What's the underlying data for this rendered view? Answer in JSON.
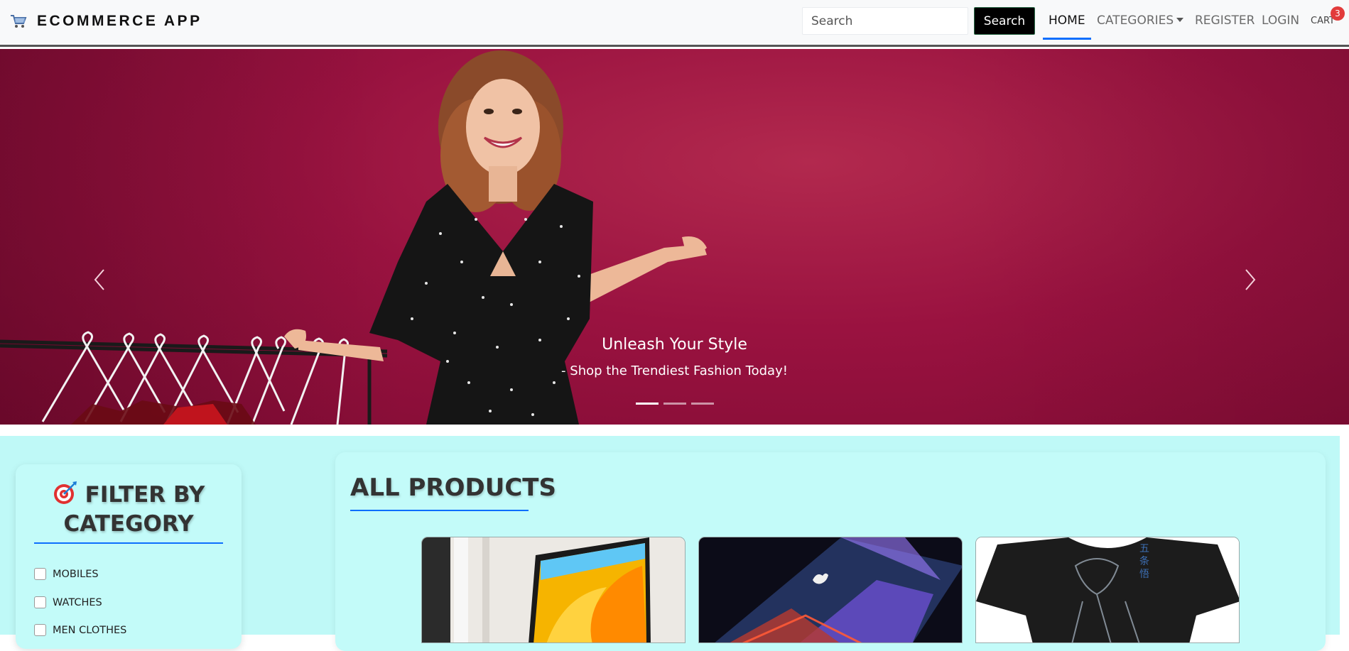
{
  "navbar": {
    "brand": "ECOMMERCE APP",
    "search_placeholder": "Search",
    "search_button": "Search",
    "links": {
      "home": "HOME",
      "categories": "CATEGORIES",
      "register": "REGISTER",
      "login": "LOGIN",
      "cart": "CART"
    },
    "cart_count": "3",
    "active_link": "HOME"
  },
  "hero": {
    "title": "Unleash Your Style",
    "subtitle": "- Shop the Trendiest Fashion Today!",
    "slide_count": 3,
    "active_slide": 1
  },
  "filter": {
    "title": "FILTER BY CATEGORY",
    "categories": [
      {
        "label": "MOBILES",
        "checked": false
      },
      {
        "label": "WATCHES",
        "checked": false
      },
      {
        "label": "MEN CLOTHES",
        "checked": false
      }
    ]
  },
  "products": {
    "title": "ALL PRODUCTS"
  },
  "colors": {
    "accent": "#0d6efd",
    "hero_background": "#9a1240",
    "content_background": "#bff9f7",
    "badge": "#e23b3b"
  }
}
